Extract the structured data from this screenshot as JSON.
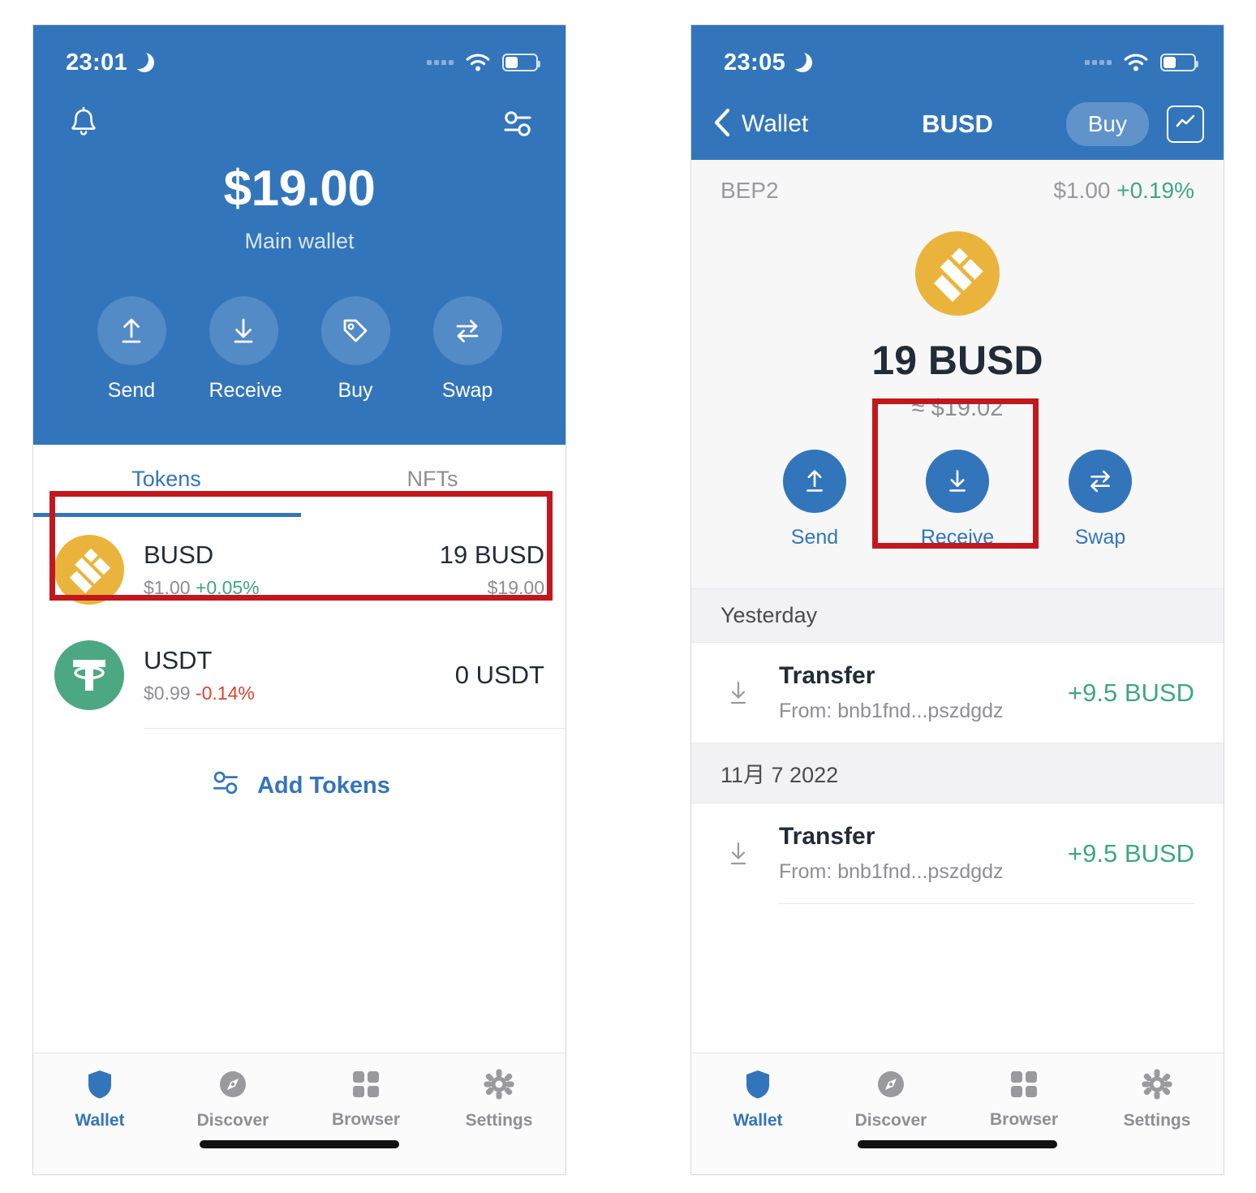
{
  "colors": {
    "brand_blue": "#3375BB",
    "accent_green": "#3FA684",
    "accent_red": "#E0412F",
    "annotation_red": "#C2171D",
    "busd_yellow": "#EAB43C",
    "usdt_green": "#4BA883"
  },
  "wallet_screen": {
    "status_bar": {
      "time": "23:01",
      "moon_icon": "moon-icon",
      "wifi_icon": "wifi-icon",
      "battery_icon": "battery-icon",
      "signal_icon": "signal-dots-icon"
    },
    "header": {
      "bell_icon": "bell-icon",
      "filter_icon": "sliders-icon",
      "balance": "$19.00",
      "wallet_name": "Main wallet"
    },
    "actions": [
      {
        "label": "Send",
        "icon": "arrow-up-icon"
      },
      {
        "label": "Receive",
        "icon": "arrow-down-icon"
      },
      {
        "label": "Buy",
        "icon": "tag-icon"
      },
      {
        "label": "Swap",
        "icon": "swap-arrows-icon"
      }
    ],
    "tabs": [
      {
        "label": "Tokens",
        "active": true
      },
      {
        "label": "NFTs",
        "active": false
      }
    ],
    "tokens": [
      {
        "symbol": "BUSD",
        "price": "$1.00",
        "change": "+0.05%",
        "change_dir": "up",
        "amount": "19 BUSD",
        "value": "$19.00",
        "logo": "busd-logo-icon"
      },
      {
        "symbol": "USDT",
        "price": "$0.99",
        "change": "-0.14%",
        "change_dir": "down",
        "amount": "0 USDT",
        "value": "",
        "logo": "usdt-logo-icon"
      }
    ],
    "add_tokens": {
      "label": "Add Tokens",
      "icon": "sliders-icon"
    }
  },
  "token_screen": {
    "status_bar": {
      "time": "23:05",
      "moon_icon": "moon-icon",
      "wifi_icon": "wifi-icon",
      "battery_icon": "battery-icon",
      "signal_icon": "signal-dots-icon"
    },
    "nav": {
      "back_label": "Wallet",
      "back_icon": "chevron-left-icon",
      "title": "BUSD",
      "buy_label": "Buy",
      "chart_icon": "line-chart-icon"
    },
    "detail": {
      "chain": "BEP2",
      "price": "$1.00",
      "change": "+0.19%",
      "logo": "busd-logo-icon",
      "amount": "19 BUSD",
      "fiat": "≈ $19.02"
    },
    "actions": [
      {
        "label": "Send",
        "icon": "arrow-up-icon"
      },
      {
        "label": "Receive",
        "icon": "arrow-down-icon"
      },
      {
        "label": "Swap",
        "icon": "swap-arrows-icon"
      }
    ],
    "transactions": [
      {
        "date_header": "Yesterday",
        "title": "Transfer",
        "from": "From: bnb1fnd...pszdgdz",
        "amount": "+9.5 BUSD",
        "icon": "arrow-down-tx-icon"
      },
      {
        "date_header": "11月 7 2022",
        "title": "Transfer",
        "from": "From: bnb1fnd...pszdgdz",
        "amount": "+9.5 BUSD",
        "icon": "arrow-down-tx-icon"
      }
    ]
  },
  "tab_bar": [
    {
      "label": "Wallet",
      "icon": "shield-icon",
      "active": true
    },
    {
      "label": "Discover",
      "icon": "compass-icon",
      "active": false
    },
    {
      "label": "Browser",
      "icon": "grid-icon",
      "active": false
    },
    {
      "label": "Settings",
      "icon": "gear-icon",
      "active": false
    }
  ]
}
